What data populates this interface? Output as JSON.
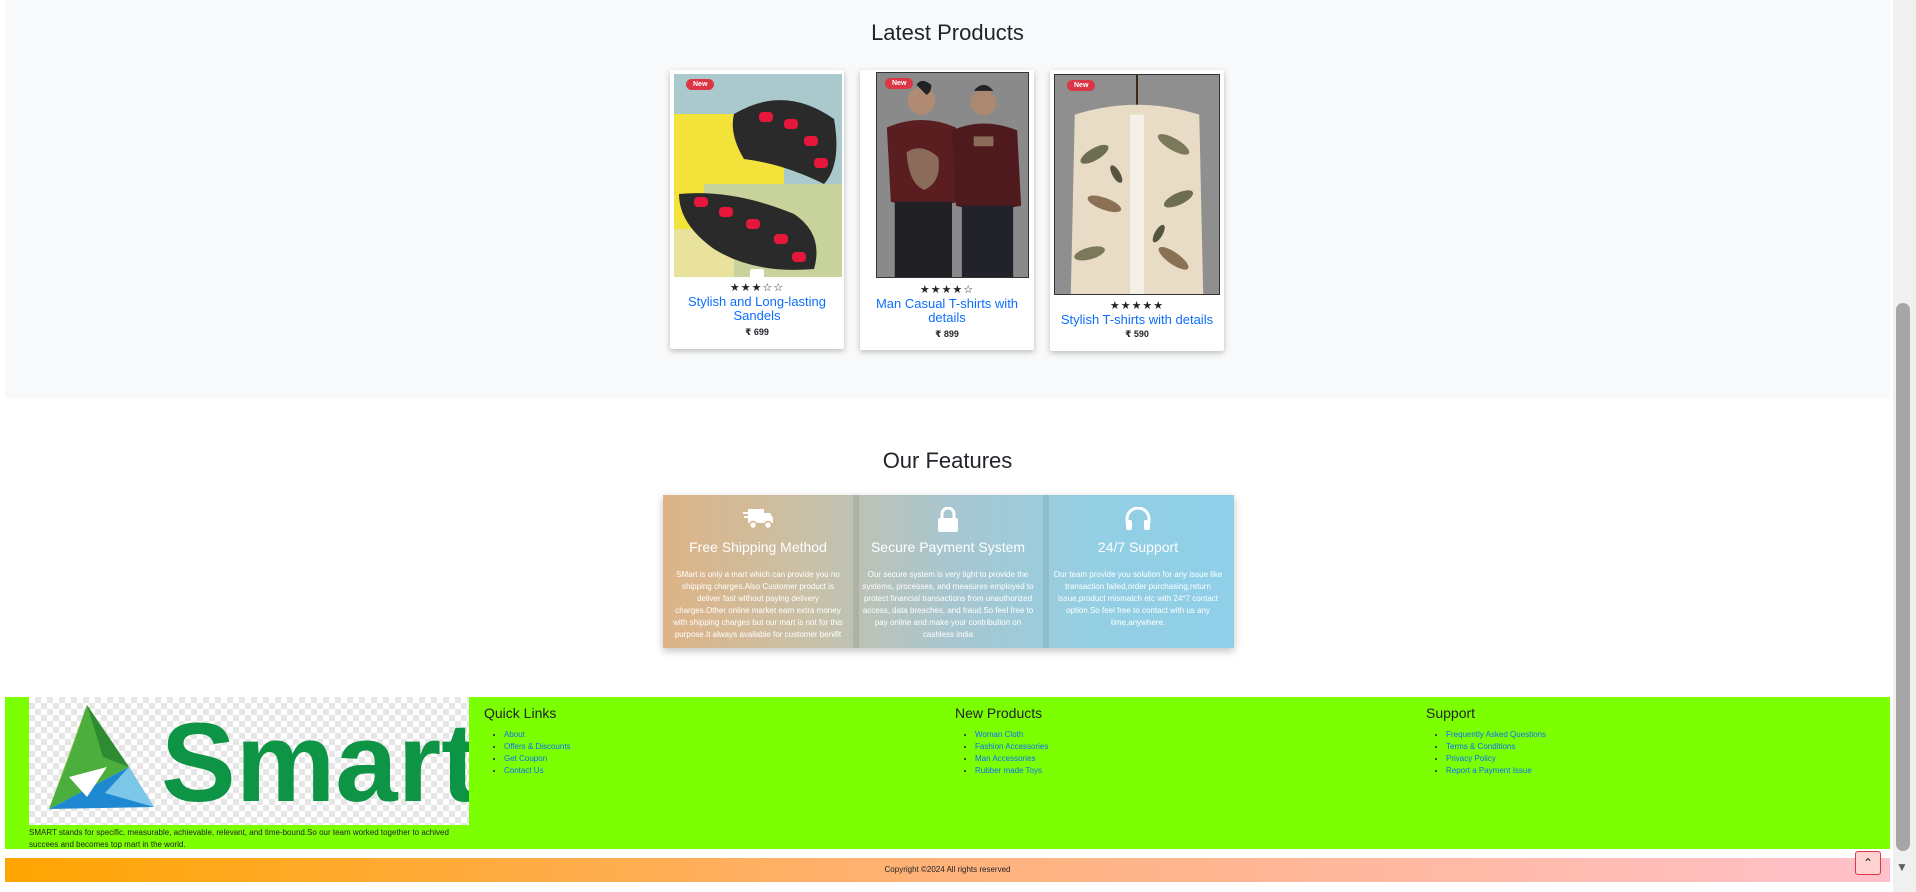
{
  "latest": {
    "heading": "Latest Products",
    "products": [
      {
        "badge": "New",
        "stars": "★★★☆☆",
        "title_line1": "Stylish and Long-lasting",
        "title_line2": "Sandels",
        "price": "₹ 699",
        "rating": 3
      },
      {
        "badge": "New",
        "stars": "★★★★☆",
        "title_line1": "Man Casual T-shirts with",
        "title_line2": "details",
        "price": "₹ 899",
        "rating": 4
      },
      {
        "badge": "New",
        "stars": "★★★★★",
        "title_line1": "Stylish T-shirts with details",
        "title_line2": "",
        "price": "₹ 590",
        "rating": 5
      }
    ]
  },
  "features": {
    "heading": "Our Features",
    "items": [
      {
        "icon": "truck-icon",
        "title": "Free Shipping Method",
        "text": "SMart is only a mart which can provide you no shipping charges.Also Customer product is deliver fast without paying delivery charges.Other online market earn extra money with shipping charges but our mart is not for this purpose.It always available for customer benifit"
      },
      {
        "icon": "lock-icon",
        "title": "Secure Payment System",
        "text": "Our secure system is very tight to provide the systems, processes, and measures employed to protect financial transactions from unauthorized access, data breaches, and fraud.So feel free to pay online and make your contribution on cashless india"
      },
      {
        "icon": "headset-icon",
        "title": "24/7 Support",
        "text": "Our team provide you solution for any issue like transaction failed,order purchasing,return issue,product mismatch etc with 24*7 contact option.So feel free to contact with us any time,anywhere."
      }
    ]
  },
  "footer": {
    "logo_text": "Smart",
    "description": "SMART stands for specific, measurable, achievable, relevant, and time-bound.So our team worked together to achived succees and becomes top mart in the world.",
    "quick_links": {
      "heading": "Quick Links",
      "items": [
        "About",
        "Offers & Discounts",
        "Get Coupon",
        "Contact Us"
      ]
    },
    "new_products": {
      "heading": "New Products",
      "items": [
        "Woman Cloth",
        "Fashion Accessories",
        "Man Accessories",
        "Rubber made Toys"
      ]
    },
    "support": {
      "heading": "Support",
      "items": [
        "Frequently Asked Questions",
        "Terms & Conditions",
        "Privacy Policy",
        "Report a Payment Issue"
      ]
    },
    "copyright": "Copyright ©2024 All rights reserved",
    "to_top": "⌃"
  },
  "colors": {
    "link": "#0d6efd",
    "badge": "#dc3545",
    "footer_bg": "#7cff00",
    "logo_green": "#0d9444"
  }
}
